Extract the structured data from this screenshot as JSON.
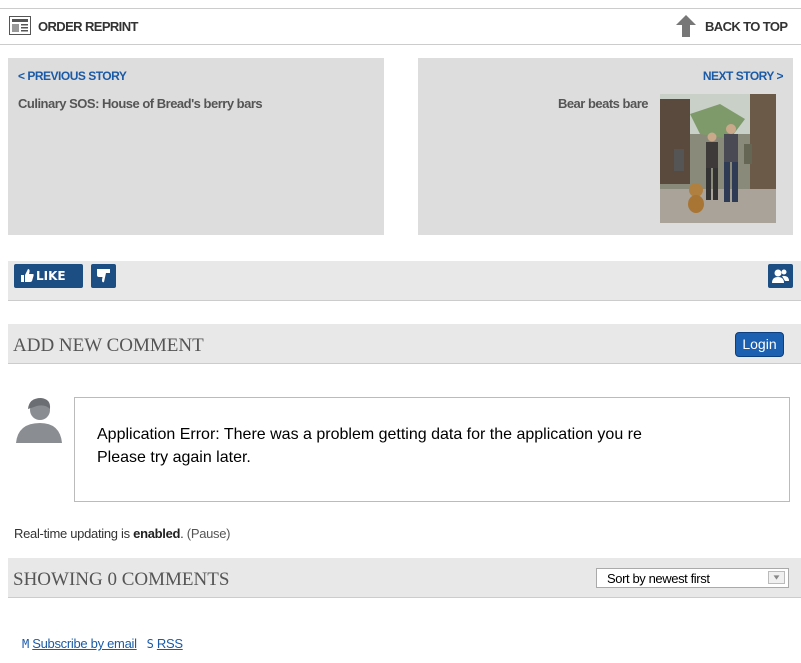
{
  "top_bar": {
    "order_reprint": "ORDER REPRINT",
    "back_to_top": "BACK TO TOP"
  },
  "previous_story": {
    "link": "< PREVIOUS STORY",
    "title": "Culinary SOS: House of Bread's berry bars"
  },
  "next_story": {
    "link": "NEXT STORY >",
    "title": "Bear beats bare"
  },
  "reactions": {
    "like_label": "LIKE",
    "like_icon": "thumbs-up-icon",
    "dislike_icon": "thumbs-down-icon",
    "profile_icon": "profile-icon"
  },
  "comments": {
    "add_title": "ADD NEW COMMENT",
    "login_label": "Login",
    "error_line1": "Application Error: There was a problem getting data for the application you re",
    "error_line2": "Please try again later.",
    "realtime_prefix": "Real-time updating is ",
    "realtime_state": "enabled",
    "realtime_suffix": ". ",
    "pause_label": "(Pause)",
    "showing_title": "SHOWING 0 COMMENTS",
    "sort_selected": "Sort by newest first"
  },
  "subscribe": {
    "email_glyph": "M",
    "email_label": "Subscribe by email",
    "rss_glyph": "S",
    "rss_label": "RSS"
  },
  "colors": {
    "accent_blue": "#1c4d83",
    "link_blue": "#1a5aa7",
    "panel_gray": "#dddddd"
  }
}
